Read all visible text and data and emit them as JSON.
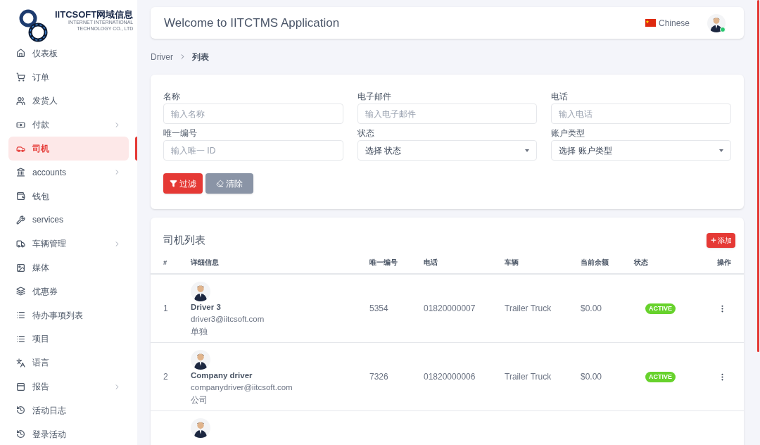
{
  "logo": {
    "name": "IITCSOFT网域信息",
    "tagline": [
      "INTERNET INTERNATIONAL",
      "TECHNOLOGY CO., LTD"
    ]
  },
  "sidebar": {
    "items": [
      {
        "label": "仪表板",
        "selected": false,
        "has_submenu": false
      },
      {
        "label": "订单",
        "selected": false,
        "has_submenu": false
      },
      {
        "label": "发货人",
        "selected": false,
        "has_submenu": false
      },
      {
        "label": "付款",
        "selected": false,
        "has_submenu": true
      },
      {
        "label": "司机",
        "selected": true,
        "has_submenu": false
      },
      {
        "label": "accounts",
        "selected": false,
        "has_submenu": true
      },
      {
        "label": "钱包",
        "selected": false,
        "has_submenu": false
      },
      {
        "label": "services",
        "selected": false,
        "has_submenu": false
      },
      {
        "label": "车辆管理",
        "selected": false,
        "has_submenu": true
      },
      {
        "label": "媒体",
        "selected": false,
        "has_submenu": false
      },
      {
        "label": "优惠券",
        "selected": false,
        "has_submenu": false
      },
      {
        "label": "待办事项列表",
        "selected": false,
        "has_submenu": false
      },
      {
        "label": "项目",
        "selected": false,
        "has_submenu": false
      },
      {
        "label": "语言",
        "selected": false,
        "has_submenu": false
      },
      {
        "label": "报告",
        "selected": false,
        "has_submenu": true
      },
      {
        "label": "活动日志",
        "selected": false,
        "has_submenu": false
      },
      {
        "label": "登录活动",
        "selected": false,
        "has_submenu": false
      }
    ]
  },
  "header": {
    "title": "Welcome to IITCTMS Application",
    "language": "Chinese",
    "user_online": true
  },
  "breadcrumb": [
    {
      "label": "Driver"
    },
    {
      "label": "列表"
    }
  ],
  "filters": {
    "fields": [
      {
        "label": "名称",
        "kind": "text",
        "placeholder": "输入名称"
      },
      {
        "label": "电子邮件",
        "kind": "text",
        "placeholder": "输入电子邮件"
      },
      {
        "label": "电话",
        "kind": "text",
        "placeholder": "输入电话"
      },
      {
        "label": "唯一编号",
        "kind": "text",
        "placeholder": "输入唯一 ID"
      },
      {
        "label": "状态",
        "kind": "select",
        "value": "选择 状态"
      },
      {
        "label": "账户类型",
        "kind": "select",
        "value": "选择 账户类型"
      }
    ],
    "buttons": [
      {
        "label": "过滤",
        "kind": "filter"
      },
      {
        "label": "清除",
        "kind": "clear"
      }
    ]
  },
  "table": {
    "title": "司机列表",
    "add_button": "添加",
    "columns": [
      "#",
      "详细信息",
      "唯一编号",
      "电话",
      "车辆",
      "当前余额",
      "状态",
      "操作"
    ],
    "rows": [
      {
        "index": "1",
        "name": "Driver 3",
        "email": "driver3@iitcsoft.com",
        "type": "单独",
        "unique_id": "5354",
        "phone": "01820000007",
        "vehicle": "Trailer Truck",
        "balance": "$0.00",
        "status": "ACTIVE"
      },
      {
        "index": "2",
        "name": "Company driver",
        "email": "companydriver@iitcsoft.com",
        "type": "公司",
        "unique_id": "7326",
        "phone": "01820000006",
        "vehicle": "Trailer Truck",
        "balance": "$0.00",
        "status": "ACTIVE"
      }
    ],
    "more_rows_below": true
  }
}
